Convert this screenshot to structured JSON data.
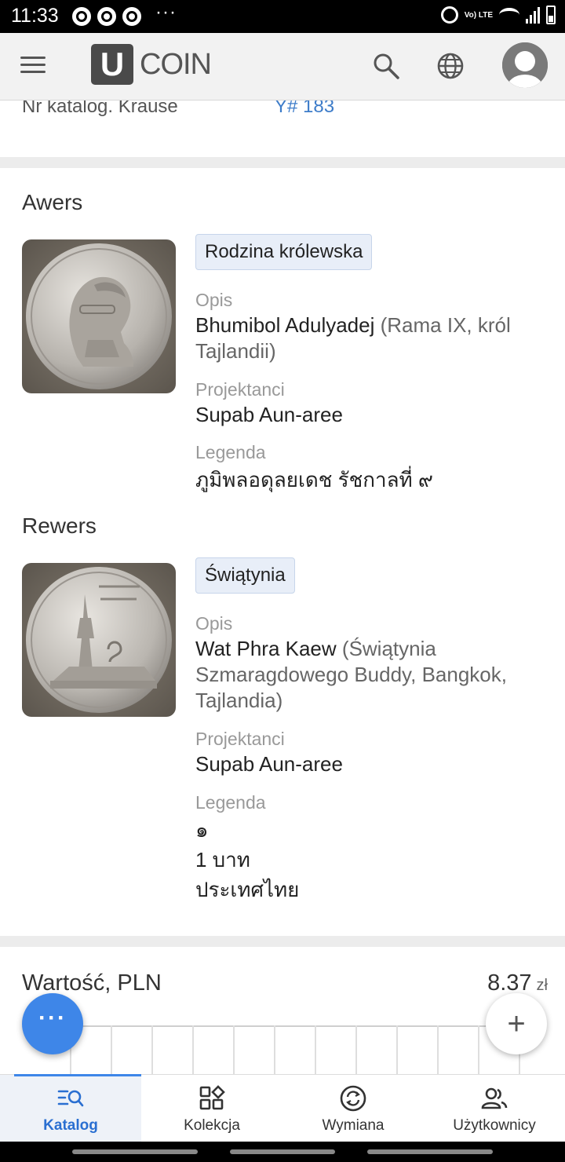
{
  "status_bar": {
    "time": "11:33",
    "more": "···",
    "network": "Vo) LTE"
  },
  "app_bar": {
    "logo_letter": "U",
    "logo_text": "COIN"
  },
  "catalog_row": {
    "label": "Nr katalog. Krause",
    "value": "Y# 183"
  },
  "obverse": {
    "title": "Awers",
    "tag": "Rodzina królewska",
    "description_label": "Opis",
    "description_main": "Bhumibol Adulyadej",
    "description_extra": "(Rama IX, król Tajlandii)",
    "designers_label": "Projektanci",
    "designers": "Supab Aun-aree",
    "legend_label": "Legenda",
    "legend": "ภูมิพลอดุลยเดช รัชกาลที่ ๙"
  },
  "reverse": {
    "title": "Rewers",
    "tag": "Świątynia",
    "description_label": "Opis",
    "description_main": "Wat Phra Kaew",
    "description_extra": "(Świątynia Szmaragdowego Buddy, Bangkok, Tajlandia)",
    "designers_label": "Projektanci",
    "designers": "Supab Aun-aree",
    "legend_label": "Legenda",
    "legend_lines": [
      "๑",
      "1 บาท",
      "ประเทศไทย"
    ]
  },
  "value": {
    "title": "Wartość, PLN",
    "amount": "8.37",
    "currency": "zł"
  },
  "fab": {
    "more": "···",
    "add": "+"
  },
  "bottom_nav": [
    {
      "label": "Katalog",
      "icon": "catalog-search-icon",
      "active": true
    },
    {
      "label": "Kolekcja",
      "icon": "collection-grid-icon",
      "active": false
    },
    {
      "label": "Wymiana",
      "icon": "exchange-icon",
      "active": false
    },
    {
      "label": "Użytkownicy",
      "icon": "users-icon",
      "active": false
    }
  ],
  "colors": {
    "accent": "#3e86e8",
    "link": "#3d7cc9",
    "tag_bg": "#e8eef8"
  }
}
